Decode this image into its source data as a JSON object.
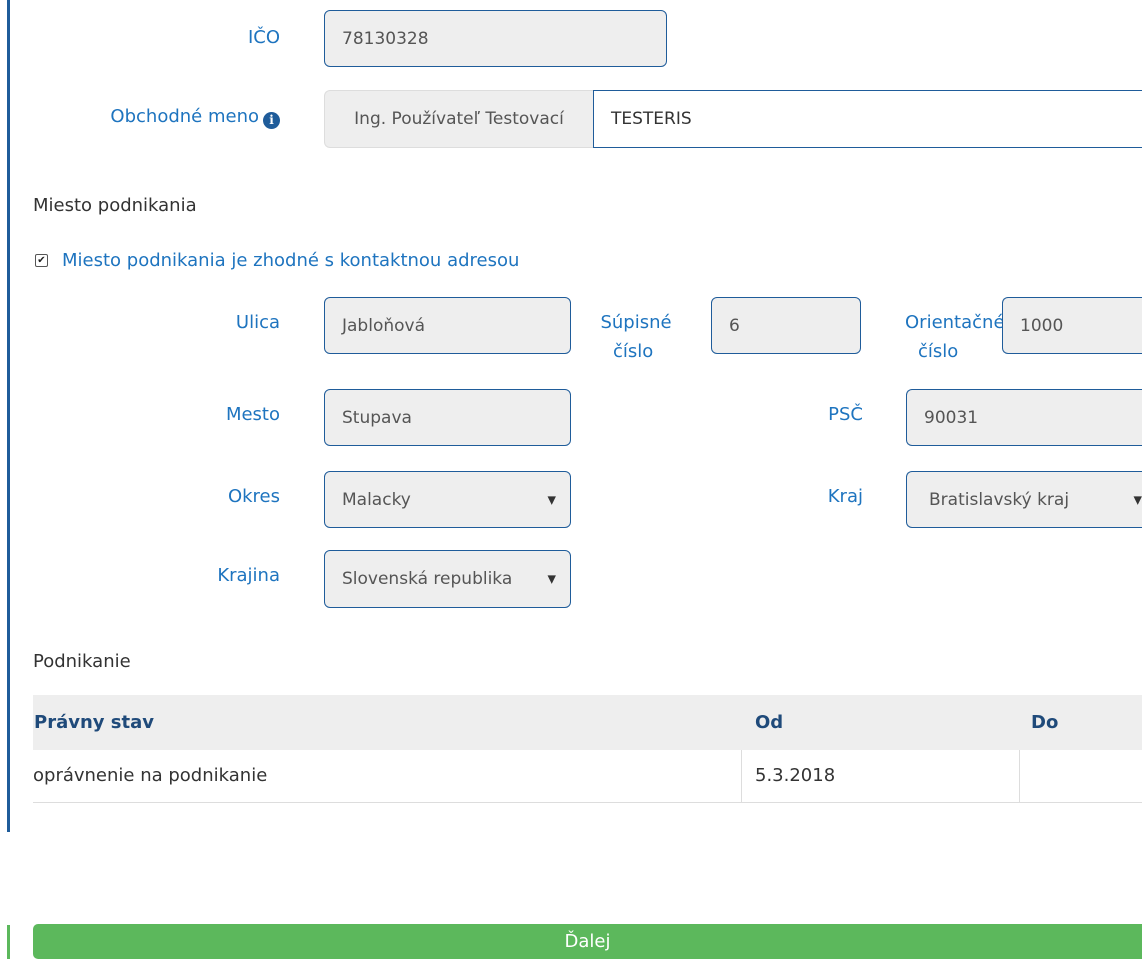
{
  "ico": {
    "label": "IČO",
    "value": "78130328"
  },
  "obchodne_meno": {
    "label": "Obchodné meno",
    "prefix": "Ing. Používateľ Testovací",
    "value": "TESTERIS"
  },
  "miesto_podnikania": {
    "title": "Miesto podnikania",
    "checkbox_label": "Miesto podnikania je zhodné s kontaktnou adresou",
    "checkbox_checked": true,
    "ulica": {
      "label": "Ulica",
      "value": "Jabloňová"
    },
    "supisne_cislo": {
      "label_line1": "Súpisné",
      "label_line2": "číslo",
      "value": "6"
    },
    "orientacne_cislo": {
      "label_line1": "Orientačné",
      "label_line2": "číslo",
      "value": "1000"
    },
    "mesto": {
      "label": "Mesto",
      "value": "Stupava"
    },
    "psc": {
      "label": "PSČ",
      "value": "90031"
    },
    "okres": {
      "label": "Okres",
      "value": "Malacky"
    },
    "kraj": {
      "label": "Kraj",
      "value": "Bratislavský kraj"
    },
    "krajina": {
      "label": "Krajina",
      "value": "Slovenská republika"
    }
  },
  "podnikanie": {
    "title": "Podnikanie",
    "columns": [
      "Právny stav",
      "Od",
      "Do"
    ],
    "rows": [
      [
        "oprávnenie na podnikanie",
        "5.3.2018",
        ""
      ]
    ]
  },
  "buttons": {
    "next": "Ďalej"
  },
  "icons": {
    "info": "info-circle-icon",
    "select_arrow": "caret-down-icon",
    "checkbox": "checkmark-icon"
  },
  "colors": {
    "label_blue": "#1e74bf",
    "border_blue": "#1f5c9a",
    "button_green": "#5cb85c"
  }
}
